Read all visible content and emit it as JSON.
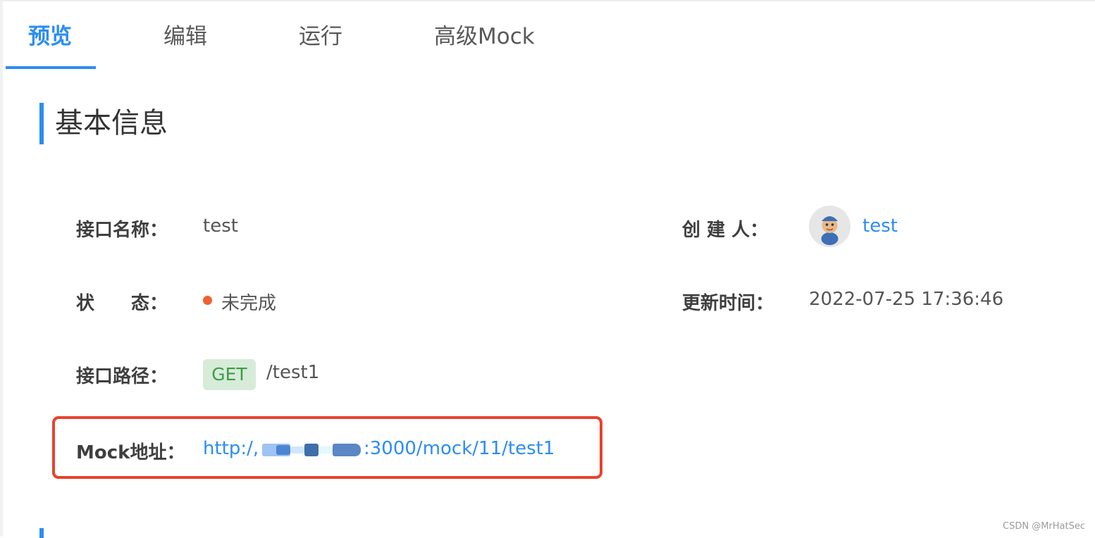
{
  "tabs": [
    {
      "label": "预览",
      "active": true
    },
    {
      "label": "编辑",
      "active": false
    },
    {
      "label": "运行",
      "active": false
    },
    {
      "label": "高级Mock",
      "active": false
    }
  ],
  "section": {
    "title": "基本信息"
  },
  "fields": {
    "name_label": "接口名称：",
    "name_value": "test",
    "status_label": "状　　态：",
    "status_value": "未完成",
    "status_color": "#ee6133",
    "path_label": "接口路径：",
    "method": "GET",
    "path_value": "/test1",
    "mock_label": "Mock地址：",
    "mock_url_prefix": "http:/,",
    "mock_url_suffix": ":3000/mock/11/test1",
    "creator_label": "创 建 人：",
    "creator_name": "test",
    "updated_label": "更新时间：",
    "updated_value": "2022-07-25 17:36:46"
  },
  "colors": {
    "accent": "#2b8df2",
    "get_tag_bg": "#d6ecd9",
    "get_tag_text": "#3f9a48",
    "highlight_border": "#e8422c"
  },
  "watermark": "CSDN @MrHatSec"
}
